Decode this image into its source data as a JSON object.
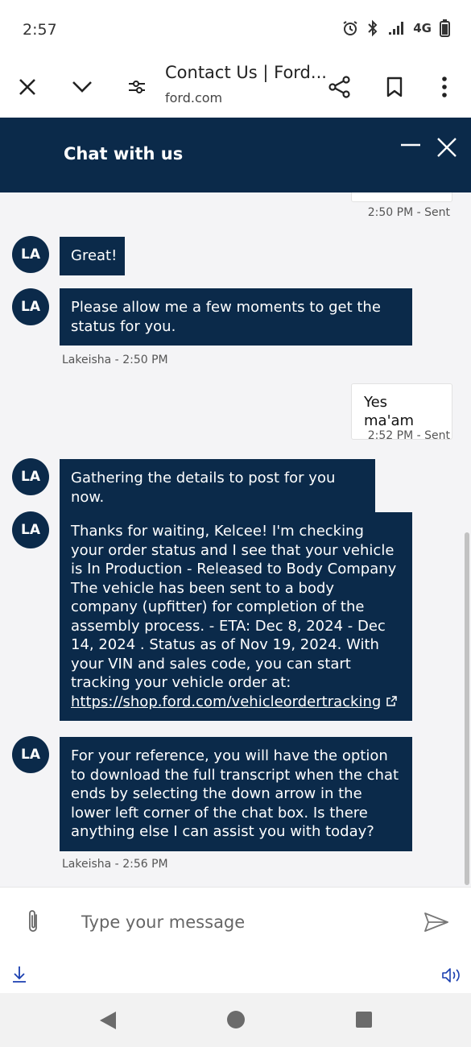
{
  "status_bar": {
    "time": "2:57",
    "network": "4G"
  },
  "browser": {
    "title": "Contact Us | Ford...",
    "domain": "ford.com"
  },
  "chat": {
    "header_title": "Chat with us",
    "messages": [
      {
        "sender": "user",
        "meta": "2:50 PM - Sent"
      },
      {
        "sender": "agent",
        "avatar": "LA",
        "text": "Great!"
      },
      {
        "sender": "agent",
        "avatar": "LA",
        "text": "Please allow me a few moments to get the status for you.",
        "meta": "Lakeisha - 2:50 PM"
      },
      {
        "sender": "user",
        "text": "Yes ma'am",
        "meta": "2:52 PM - Sent"
      },
      {
        "sender": "agent",
        "avatar": "LA",
        "text": "Gathering the details to post for you now."
      },
      {
        "sender": "agent",
        "avatar": "LA",
        "text_line1": "Thanks for waiting, Kelcee! I'm checking your order status and I see that your vehicle is In Production - Released to Body Company",
        "text_line2": "The vehicle has been sent to a body company (upfitter) for completion of the assembly process. - ETA: Dec 8, 2024 - Dec 14, 2024 . Status as of Nov 19, 2024. With your VIN and sales code, you can start tracking your vehicle order at:",
        "link": "https://shop.ford.com/vehicleordertracking"
      },
      {
        "sender": "agent",
        "avatar": "LA",
        "text": "For your reference, you will have the option to download the full transcript when the chat ends by selecting the down arrow in the lower left corner of the chat box. Is there anything else I can assist you with today?",
        "meta": "Lakeisha - 2:56 PM"
      }
    ]
  },
  "composer": {
    "placeholder": "Type your message"
  },
  "colors": {
    "chat_navy": "#0b2a4a",
    "background": "#f4f4f6",
    "link_blue": "#1a3fb0"
  }
}
